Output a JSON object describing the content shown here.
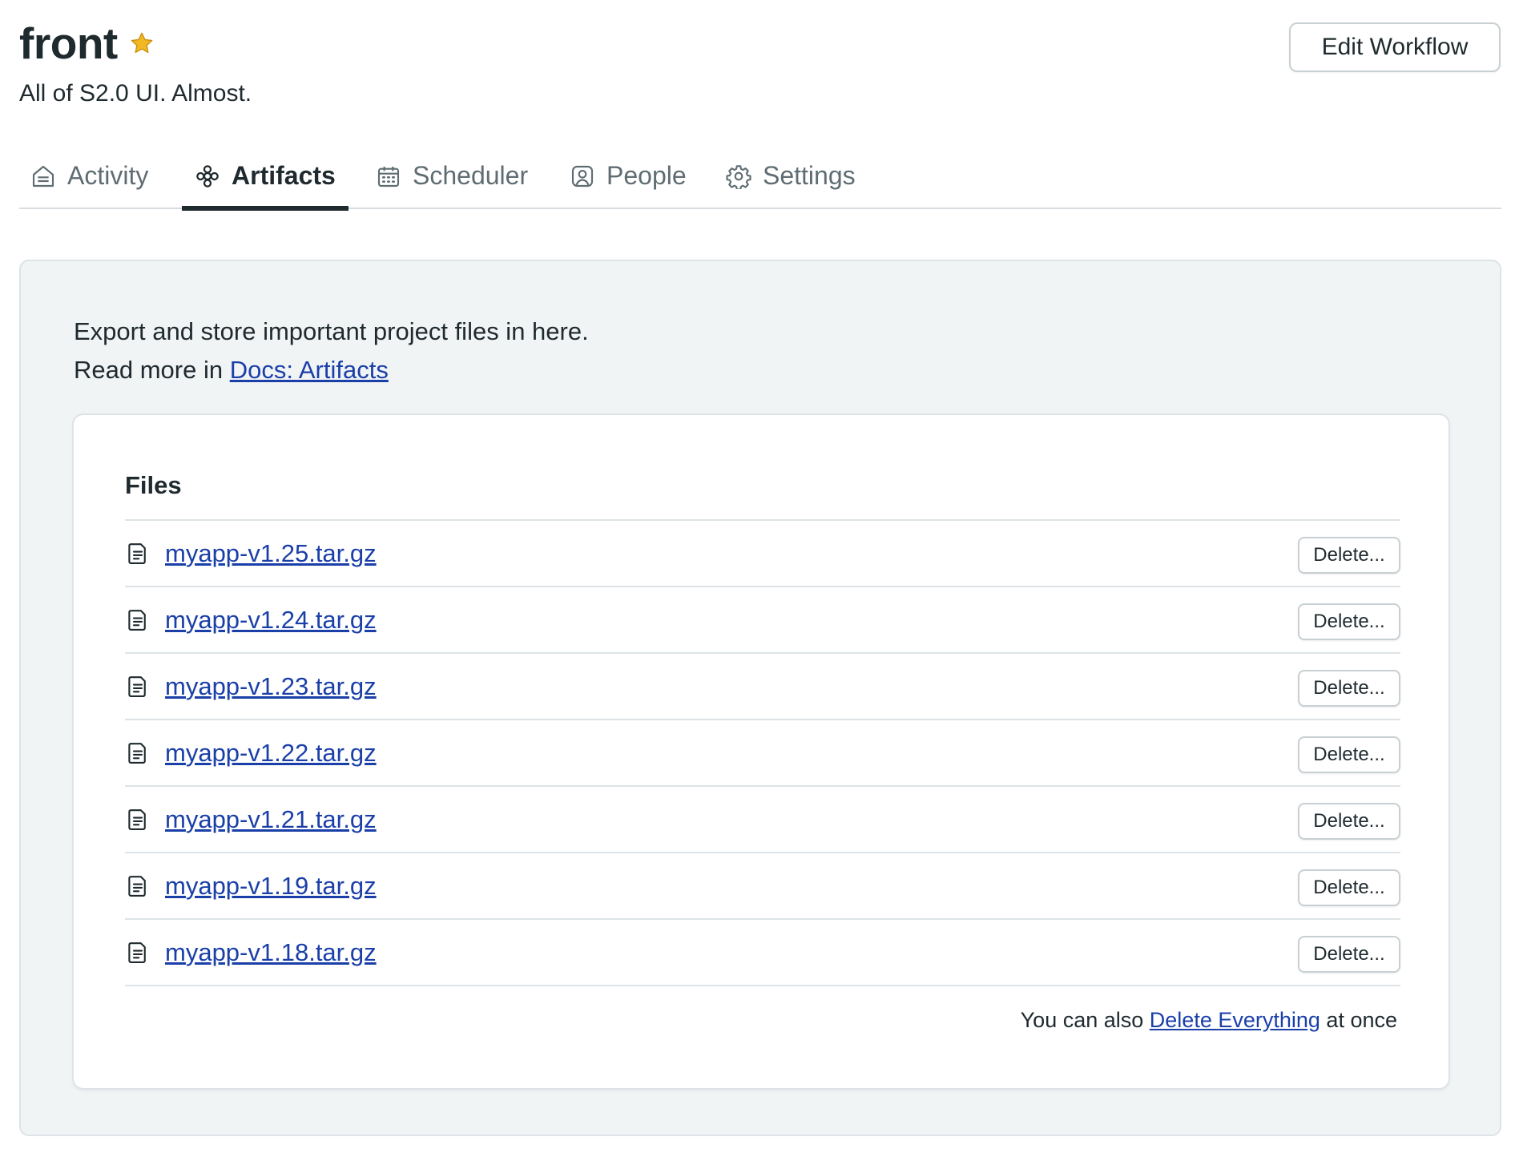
{
  "header": {
    "title": "front",
    "subtitle": "All of S2.0 UI. Almost.",
    "edit_button": "Edit Workflow",
    "star_icon": "star-icon",
    "star_color": "#f2b824"
  },
  "tabs": [
    {
      "label": "Activity",
      "icon": "activity-icon",
      "active": false
    },
    {
      "label": "Artifacts",
      "icon": "artifacts-icon",
      "active": true
    },
    {
      "label": "Scheduler",
      "icon": "calendar-icon",
      "active": false
    },
    {
      "label": "People",
      "icon": "person-icon",
      "active": false
    },
    {
      "label": "Settings",
      "icon": "gear-icon",
      "active": false
    }
  ],
  "intro": {
    "line1": "Export and store important project files in here.",
    "line2_prefix": "Read more in ",
    "docs_link": "Docs: Artifacts"
  },
  "files": {
    "heading": "Files",
    "items": [
      {
        "name": "myapp-v1.25.tar.gz",
        "delete_label": "Delete..."
      },
      {
        "name": "myapp-v1.24.tar.gz",
        "delete_label": "Delete..."
      },
      {
        "name": "myapp-v1.23.tar.gz",
        "delete_label": "Delete..."
      },
      {
        "name": "myapp-v1.22.tar.gz",
        "delete_label": "Delete..."
      },
      {
        "name": "myapp-v1.21.tar.gz",
        "delete_label": "Delete..."
      },
      {
        "name": "myapp-v1.19.tar.gz",
        "delete_label": "Delete..."
      },
      {
        "name": "myapp-v1.18.tar.gz",
        "delete_label": "Delete..."
      }
    ],
    "footer_prefix": "You can also ",
    "footer_link": "Delete Everything",
    "footer_suffix": " at once"
  },
  "colors": {
    "text": "#1f2a2e",
    "link": "#1a3fa8",
    "panel_bg": "#f1f4f5",
    "muted_tab": "#5f6d72"
  }
}
